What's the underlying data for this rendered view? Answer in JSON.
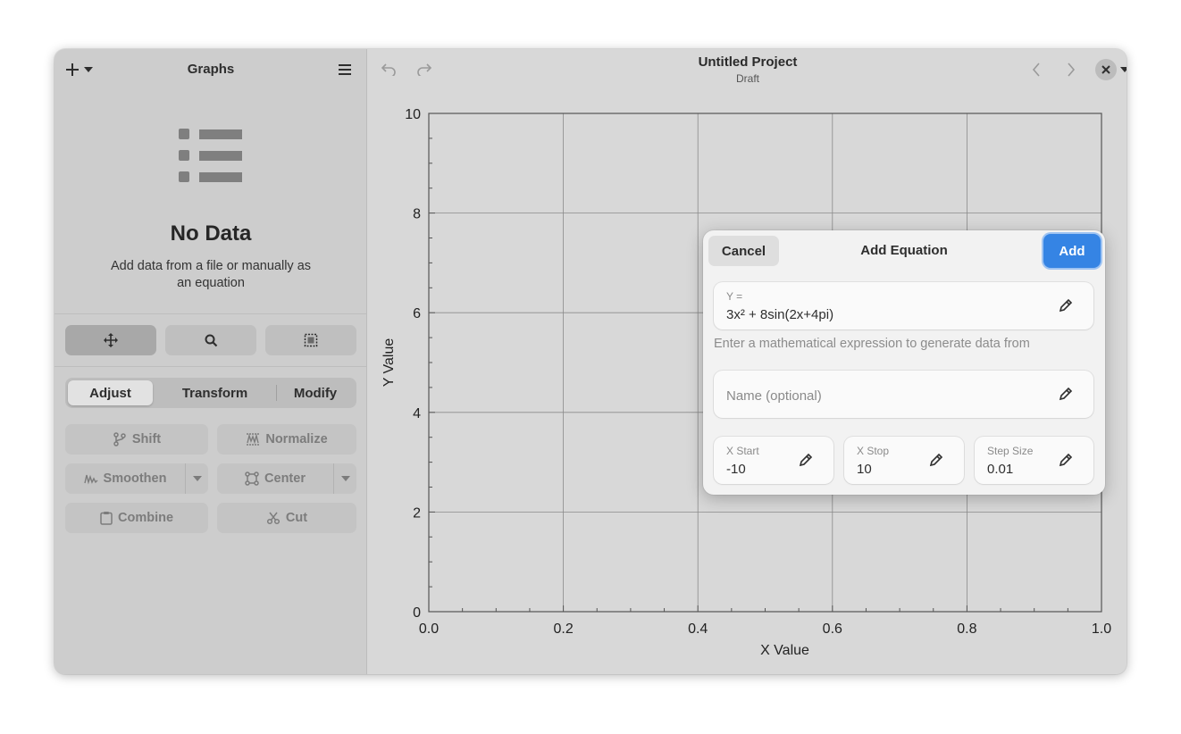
{
  "sidebar": {
    "title": "Graphs",
    "empty_title": "No Data",
    "empty_description": "Add data from a file or manually as an equation",
    "segments": [
      {
        "label": "Adjust",
        "active": true
      },
      {
        "label": "Transform",
        "active": false
      },
      {
        "label": "Modify",
        "active": false
      }
    ],
    "operations": {
      "shift": "Shift",
      "normalize": "Normalize",
      "smoothen": "Smoothen",
      "center": "Center",
      "combine": "Combine",
      "cut": "Cut"
    }
  },
  "header": {
    "title": "Untitled Project",
    "subtitle": "Draft"
  },
  "chart_data": {
    "type": "line",
    "series": [],
    "xlabel": "X Value",
    "ylabel": "Y Value",
    "xlim": [
      0,
      1
    ],
    "ylim": [
      0,
      10
    ],
    "x_ticks": [
      "0.0",
      "0.2",
      "0.4",
      "0.6",
      "0.8",
      "1.0"
    ],
    "y_ticks": [
      "0",
      "2",
      "4",
      "6",
      "8",
      "10"
    ],
    "grid": true
  },
  "dialog": {
    "title": "Add Equation",
    "cancel_label": "Cancel",
    "add_label": "Add",
    "equation_label": "Y =",
    "equation_value": "3x² + 8sin(2x+4pi)",
    "hint": "Enter a mathematical expression to generate data from",
    "name_placeholder": "Name (optional)",
    "x_start_label": "X Start",
    "x_start_value": "-10",
    "x_stop_label": "X Stop",
    "x_stop_value": "10",
    "step_size_label": "Step Size",
    "step_size_value": "0.01"
  },
  "colors": {
    "accent": "#3584e4",
    "grid": "#8a8a8a"
  }
}
